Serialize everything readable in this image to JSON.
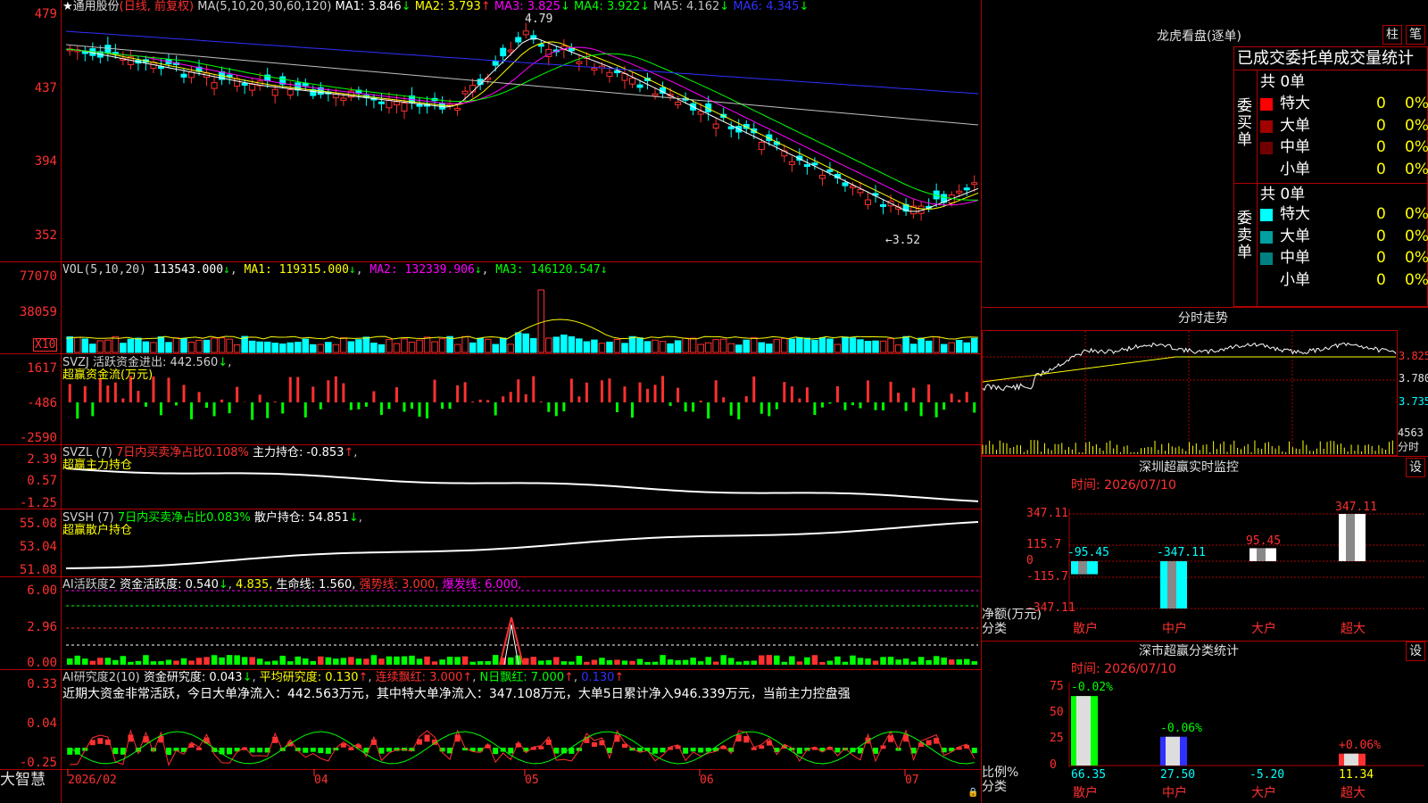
{
  "main": {
    "stock_name": "通用股份",
    "period": "(日线, 前复权)",
    "ma_header": "MA(5,10,20,30,60,120)",
    "ma": [
      {
        "label": "MA1: 3.846",
        "arrow": "↓",
        "color": "#ffffff"
      },
      {
        "label": "MA2: 3.793",
        "arrow": "↑",
        "color": "#ffff00"
      },
      {
        "label": "MA3: 3.825",
        "arrow": "↓",
        "color": "#ff00ff"
      },
      {
        "label": "MA4: 3.922",
        "arrow": "↓",
        "color": "#00ff00"
      },
      {
        "label": "MA5: 4.162",
        "arrow": "↓",
        "color": "#c0c0c0"
      },
      {
        "label": "MA6: 4.345",
        "arrow": "↓",
        "color": "#3030ff"
      }
    ],
    "y_ticks": [
      "479",
      "437",
      "394",
      "352"
    ],
    "high_marker": "4.79",
    "low_marker": "←3.52"
  },
  "vol": {
    "header": "VOL(5,10,20)",
    "value": "113543.000",
    "ma1": "MA1: 119315.000",
    "ma2": "MA2: 132339.906",
    "ma3": "MA3: 146120.547",
    "y_ticks": [
      "77070",
      "38059"
    ],
    "unit": "X10"
  },
  "svzj": {
    "header": "SVZJ  活跃资金进出: 442.560",
    "sub": "超赢资金流(万元)",
    "y_ticks": [
      "1617",
      "-486",
      "-2590"
    ]
  },
  "svzl": {
    "header": "SVZL (7)",
    "pct": "7日内买卖净占比0.108%",
    "hold": "主力持仓: -0.853",
    "sub": "超赢主力持仓",
    "y_ticks": [
      "2.39",
      "0.57",
      "-1.25"
    ]
  },
  "svsh": {
    "header": "SVSH (7)",
    "pct": "7日内买卖净占比0.083%",
    "hold": "散户持仓: 54.851",
    "sub": "超赢散户持仓",
    "y_ticks": [
      "55.08",
      "53.04",
      "51.08"
    ]
  },
  "ai2": {
    "header": "AI活跃度2",
    "act": "资金活跃度: 0.540",
    "v2": "4.835,",
    "life": "生命线: 1.560,",
    "strong": "强势线: 3.000,",
    "burst": "爆发线: 6.000,",
    "y_ticks": [
      "6.00",
      "2.96",
      "0.00"
    ]
  },
  "ai_research": {
    "header": "AI研究度2(10)",
    "research": "资金研究度: 0.043",
    "avg": "平均研究度: 0.130",
    "cont": "连续飘红: 3.000",
    "nday": "N日飘红: 7.000",
    "last": "0.130",
    "note": "近期大资金非常活跃，今日大单净流入：442.563万元，其中特大单净流入：347.108万元，大单5日累计净入946.339万元，当前主力控盘强",
    "y_ticks": [
      "0.33",
      "0.04",
      "-0.25"
    ]
  },
  "xaxis": {
    "labels": [
      "2026/02",
      "04",
      "05",
      "06",
      "07"
    ],
    "brand": "大智慧"
  },
  "right": {
    "title": "龙虎看盘(逐单)",
    "btn_zhu": "柱",
    "btn_bi": "笔",
    "stats_title": "已成交委托单成交量统计",
    "buy_label": "委买单",
    "sell_label": "委卖单",
    "buy_total": "共 0单",
    "sell_total": "共 0单",
    "buy_rows": [
      {
        "name": "特大",
        "val": "0",
        "pct": "0%",
        "color": "#ff0000"
      },
      {
        "name": "大单",
        "val": "0",
        "pct": "0%",
        "color": "#a00000"
      },
      {
        "name": "中单",
        "val": "0",
        "pct": "0%",
        "color": "#700000"
      },
      {
        "name": "小单",
        "val": "0",
        "pct": "0%",
        "color": "#000000"
      }
    ],
    "sell_rows": [
      {
        "name": "特大",
        "val": "0",
        "pct": "0%",
        "color": "#00ffff"
      },
      {
        "name": "大单",
        "val": "0",
        "pct": "0%",
        "color": "#00a0a0"
      },
      {
        "name": "中单",
        "val": "0",
        "pct": "0%",
        "color": "#008080"
      },
      {
        "name": "小单",
        "val": "0",
        "pct": "0%",
        "color": "#000000"
      }
    ],
    "intraday_title": "分时走势",
    "intraday_ticks": [
      "3.825",
      "3.780",
      "3.735"
    ],
    "intraday_vol": "4563",
    "intraday_vol_unit": "分时",
    "sz_title": "深圳超赢实时监控",
    "sz_set": "设",
    "sz_time": "时间: 2026/07/10",
    "sz_ticks": [
      "347.11",
      "115.7",
      "0",
      "-115.7",
      "-347.11"
    ],
    "sz_ylabel": "净额(万元)",
    "sz_xlabel": "分类",
    "sz_bars": [
      {
        "cat": "散户",
        "value": "-95.45",
        "num": -95.45
      },
      {
        "cat": "中户",
        "value": "-347.11",
        "num": -347.11
      },
      {
        "cat": "大户",
        "value": "95.45",
        "num": 95.45
      },
      {
        "cat": "超大",
        "value": "347.11",
        "num": 347.11
      }
    ],
    "sh_title": "深市超赢分类统计",
    "sh_set": "设",
    "sh_time": "时间: 2026/07/10",
    "sh_ticks": [
      "75",
      "50",
      "25",
      "0"
    ],
    "sh_ylabel": "比例%",
    "sh_xlabel": "分类",
    "sh_bars": [
      {
        "cat": "散户",
        "top": "-0.02%",
        "bottom": "66.35",
        "num": 66.35
      },
      {
        "cat": "中户",
        "top": "-0.06%",
        "bottom": "27.50",
        "num": 27.5
      },
      {
        "cat": "大户",
        "top": "",
        "bottom": "-5.20",
        "num": 0
      },
      {
        "cat": "超大",
        "top": "+0.06%",
        "bottom": "11.34",
        "num": 11.34
      }
    ]
  }
}
